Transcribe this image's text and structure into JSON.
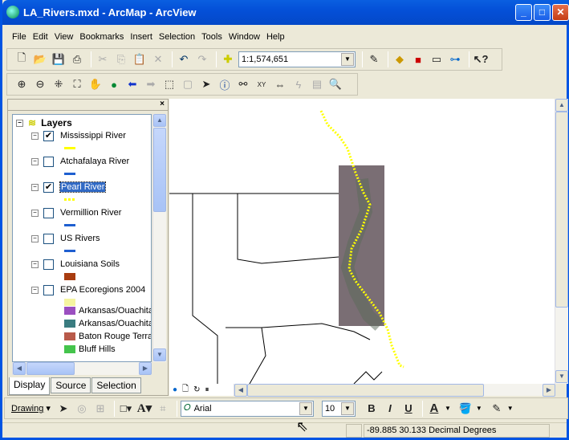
{
  "window": {
    "title": "LA_Rivers.mxd - ArcMap - ArcView",
    "controls": [
      "minimize",
      "maximize",
      "close"
    ]
  },
  "menu": [
    "File",
    "Edit",
    "View",
    "Bookmarks",
    "Insert",
    "Selection",
    "Tools",
    "Window",
    "Help"
  ],
  "standard_toolbar": {
    "scale": "1:1,574,651",
    "icons": [
      "new-icon",
      "open-icon",
      "save-icon",
      "print-icon",
      "cut-icon",
      "copy-icon",
      "paste-icon",
      "delete-icon",
      "undo-icon",
      "redo-icon",
      "add-data-icon",
      "editor-icon",
      "arccatalog-icon",
      "arctoolbox-icon",
      "command-line-icon",
      "modelbuilder-icon",
      "whats-this-icon"
    ]
  },
  "tools_toolbar": {
    "icons": [
      "zoom-in-icon",
      "zoom-out-icon",
      "fixed-zoom-in-icon",
      "fixed-zoom-out-icon",
      "pan-icon",
      "full-extent-icon",
      "back-icon",
      "forward-icon",
      "select-features-icon",
      "clear-selection-icon",
      "select-elements-icon",
      "identify-icon",
      "find-icon",
      "go-to-xy-icon",
      "measure-icon",
      "hyperlink-icon",
      "html-popup-icon",
      "magnifier-icon"
    ]
  },
  "toc": {
    "root": "Layers",
    "layers": [
      {
        "name": "Mississippi River",
        "checked": true,
        "symbol": "#ffff00",
        "style": "line"
      },
      {
        "name": "Atchafalaya River",
        "checked": false,
        "symbol": "#1f5fd0",
        "style": "line"
      },
      {
        "name": "Pearl River",
        "checked": true,
        "selected": true,
        "symbol": "#ffff00",
        "style": "dots"
      },
      {
        "name": "Vermillion River",
        "checked": false,
        "symbol": "#1f5fd0",
        "style": "line"
      },
      {
        "name": "US Rivers",
        "checked": false,
        "symbol": "#1f5fd0",
        "style": "line"
      },
      {
        "name": "Louisiana Soils",
        "checked": false,
        "symbol": "#a83c10",
        "style": "fill"
      },
      {
        "name": "EPA Ecoregions 2004",
        "checked": false,
        "symbol": "#f5f5a0",
        "style": "fill"
      }
    ],
    "legend": [
      {
        "label": "Arkansas/Ouachita",
        "color": "#9b4fc0"
      },
      {
        "label": "Arkansas/Ouachita",
        "color": "#3a7c80"
      },
      {
        "label": "Baton Rouge Terrac",
        "color": "#b85a4a"
      },
      {
        "label": "Bluff Hills",
        "color": "#44c44c"
      }
    ],
    "tabs": [
      "Display",
      "Source",
      "Selection"
    ]
  },
  "drawing_toolbar": {
    "label": "Drawing",
    "font": "Arial",
    "size": "10",
    "bold": "B",
    "italic": "I",
    "underline": "U",
    "text_color": "A"
  },
  "status": {
    "coords": "-89.885  30.133 Decimal Degrees"
  }
}
